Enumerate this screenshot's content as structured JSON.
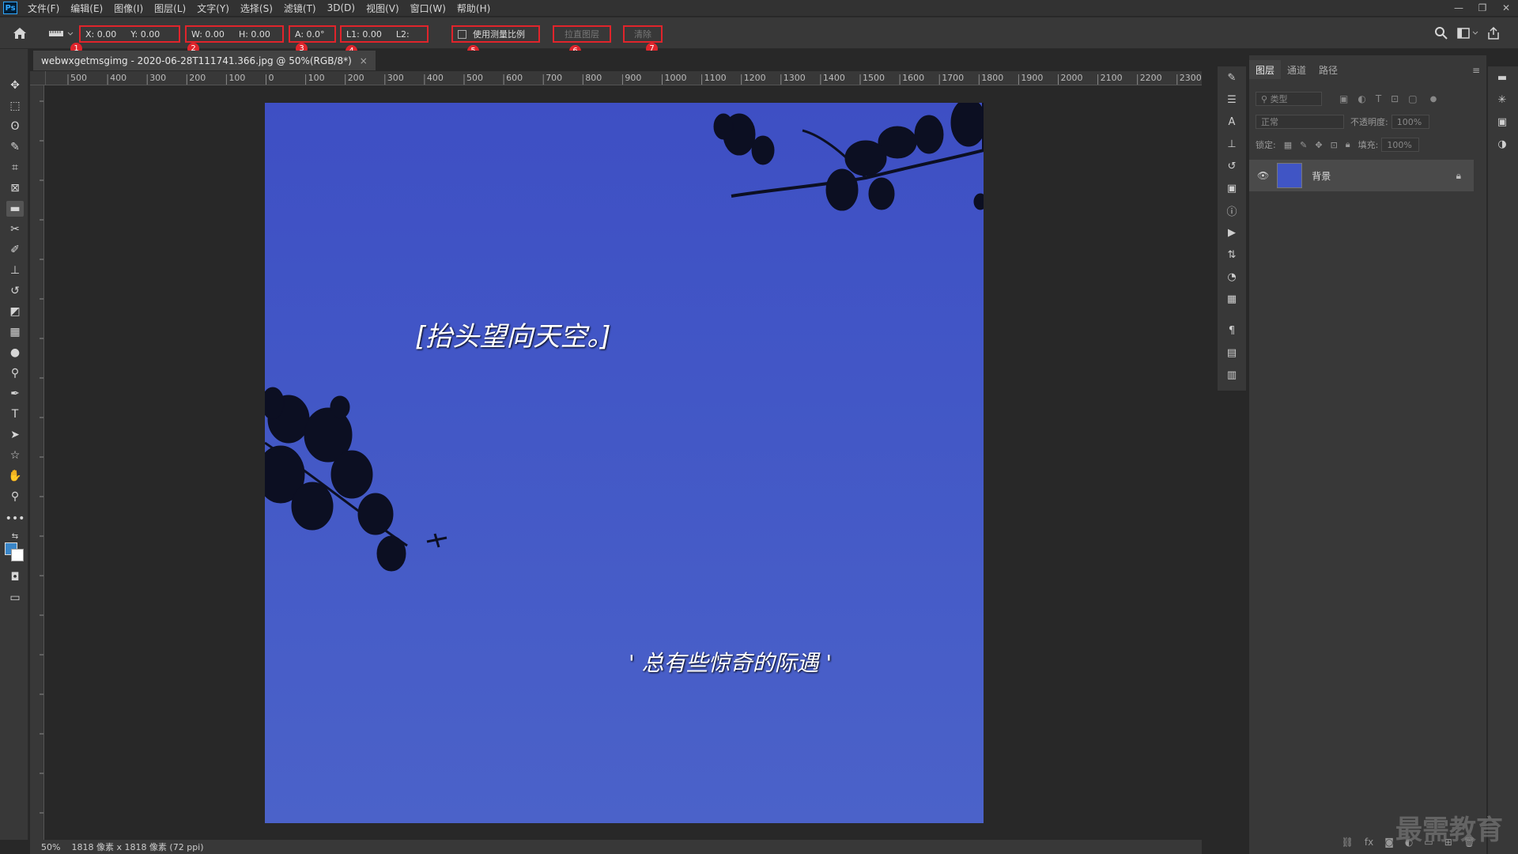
{
  "app": {
    "logo": "Ps"
  },
  "menu": [
    "文件(F)",
    "编辑(E)",
    "图像(I)",
    "图层(L)",
    "文字(Y)",
    "选择(S)",
    "滤镜(T)",
    "3D(D)",
    "视图(V)",
    "窗口(W)",
    "帮助(H)"
  ],
  "window_controls": {
    "minimize": "—",
    "restore": "❐",
    "close": "✕"
  },
  "options": {
    "x_label": "X: 0.00",
    "y_label": "Y: 0.00",
    "w_label": "W: 0.00",
    "h_label": "H: 0.00",
    "angle_label": "A: 0.0°",
    "l1_label": "L1: 0.00",
    "l2_label": "L2:",
    "use_scale_label": "使用测量比例",
    "straighten_label": "拉直图层",
    "clear_label": "清除",
    "markers": [
      "1",
      "2",
      "3",
      "4",
      "5",
      "6",
      "7"
    ]
  },
  "document": {
    "tab_title": "webwxgetmsgimg - 2020-06-28T111741.366.jpg @ 50%(RGB/8*)",
    "tab_close": "×"
  },
  "ruler_h_labels": [
    "500",
    "400",
    "300",
    "200",
    "100",
    "0",
    "100",
    "200",
    "300",
    "400",
    "500",
    "600",
    "700",
    "800",
    "900",
    "1000",
    "1100",
    "1200",
    "1300",
    "1400",
    "1500",
    "1600",
    "1700",
    "1800",
    "1900",
    "2000",
    "2100",
    "2200",
    "2300"
  ],
  "image": {
    "caption1": "[抬头望向天空。]",
    "caption2": "' 总有些惊奇的际遇 '",
    "sky_color": "#4257c6"
  },
  "status": {
    "zoom": "50%",
    "info": "1818 像素 x 1818 像素 (72 ppi)"
  },
  "layers_panel": {
    "tabs": [
      "图层",
      "通道",
      "路径"
    ],
    "filter_placeholder": "类型",
    "blend_mode": "正常",
    "opacity_label": "不透明度:",
    "opacity_value": "100%",
    "lock_label": "锁定:",
    "fill_label": "填充:",
    "fill_value": "100%",
    "layer_name": "背景"
  },
  "watermark": "最需教育",
  "accent_color": "#e0242b"
}
